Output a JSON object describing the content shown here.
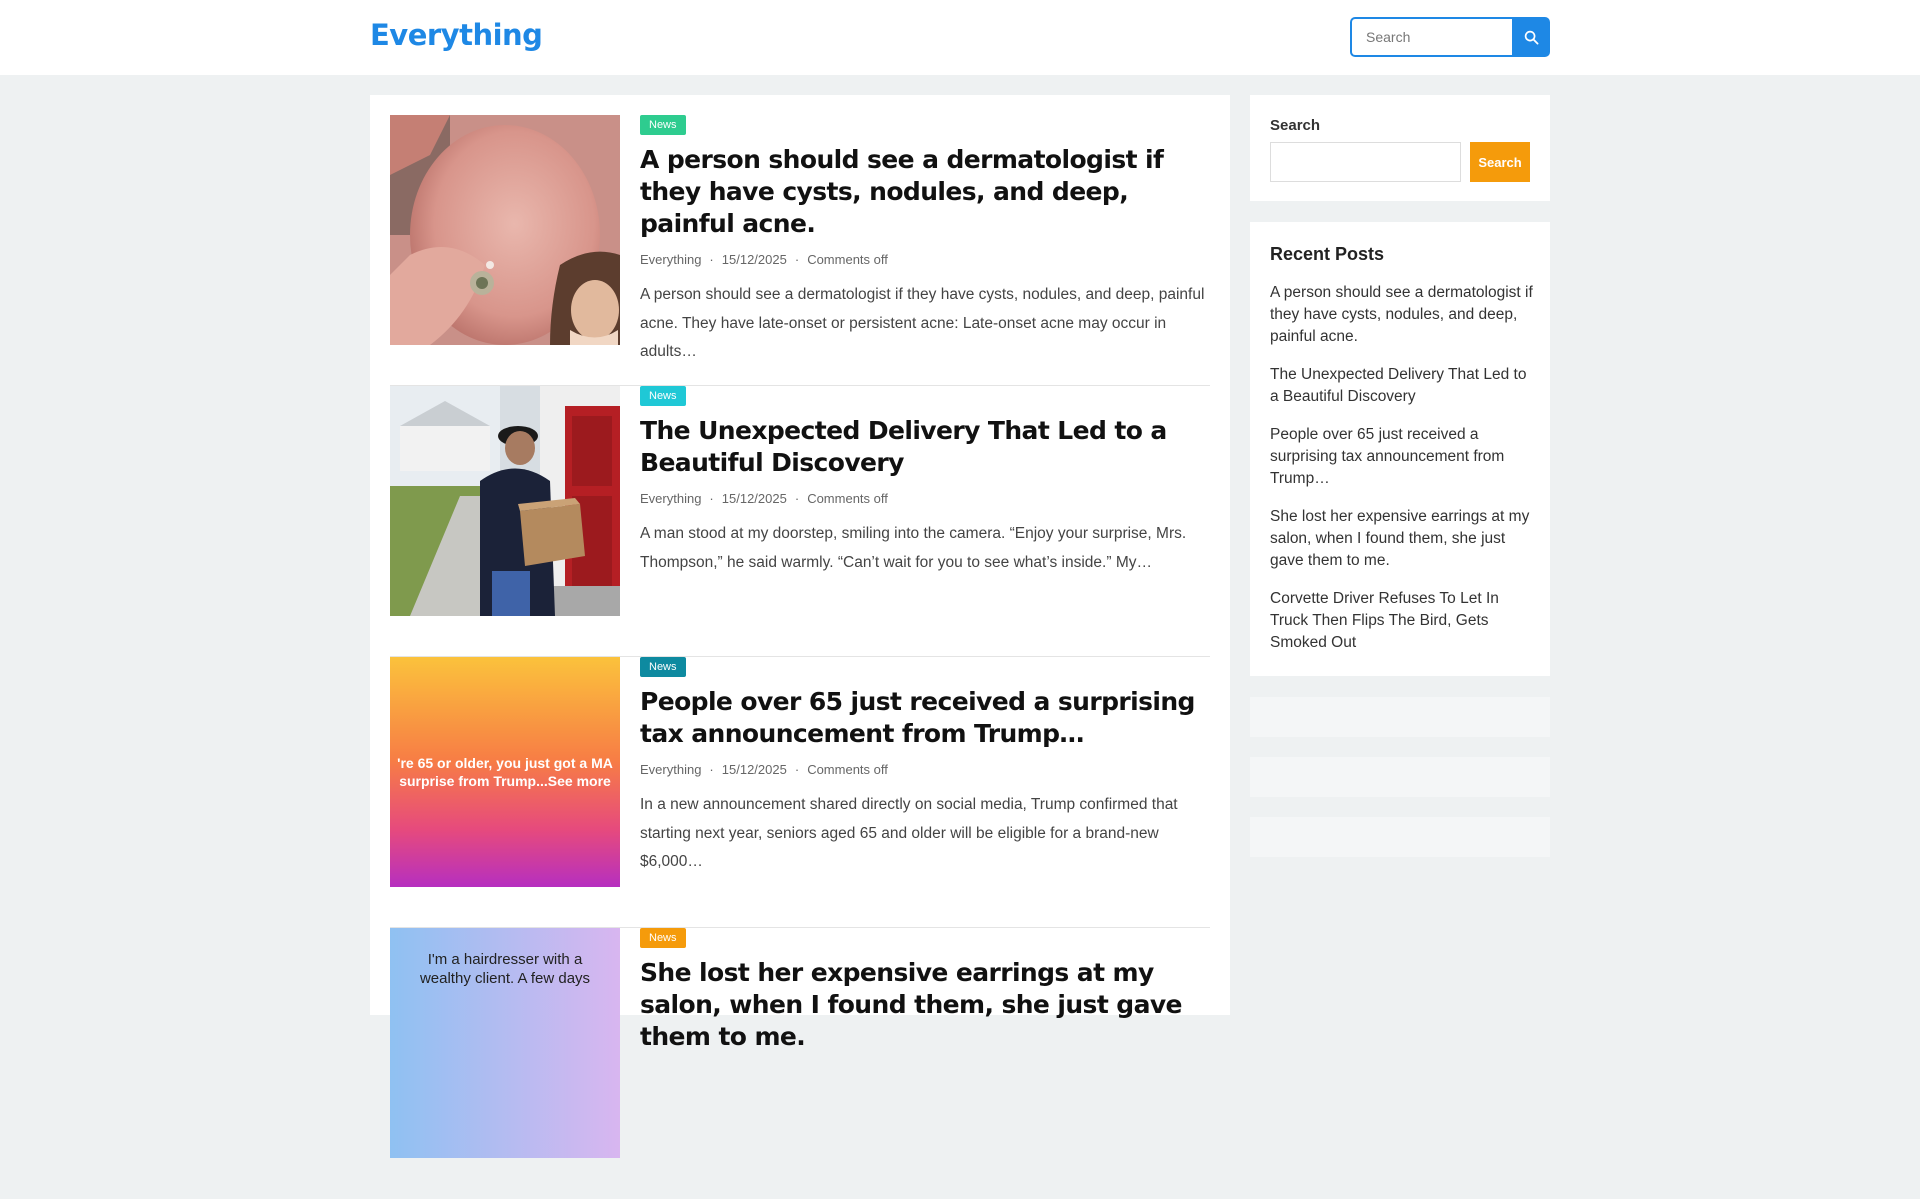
{
  "site": {
    "title": "Everything"
  },
  "header_search": {
    "placeholder": "Search"
  },
  "posts": [
    {
      "category": "News",
      "category_color": "#2ecc8f",
      "title": "A person should see a dermatologist if they have cysts, nodules, and deep, painful acne.",
      "author": "Everything",
      "date": "15/12/2025",
      "comments": "Comments off",
      "excerpt": "A person should see a dermatologist if they have cysts, nodules, and deep, painful acne. They have late-onset or persistent acne: Late-onset acne may occur in adults…"
    },
    {
      "category": "News",
      "category_color": "#1fc8d6",
      "title": "The Unexpected Delivery That Led to a Beautiful Discovery",
      "author": "Everything",
      "date": "15/12/2025",
      "comments": "Comments off",
      "excerpt": "A man stood at my doorstep, smiling into the camera. “Enjoy your surprise, Mrs. Thompson,” he said warmly. “Can’t wait for you to see what’s inside.” My…"
    },
    {
      "category": "News",
      "category_color": "#0e8aa0",
      "title": "People over 65 just received a surprising tax announcement from Trump…",
      "author": "Everything",
      "date": "15/12/2025",
      "comments": "Comments off",
      "excerpt": "In a new announcement shared directly on social media, Trump confirmed that starting next year, seniors aged 65 and older will be eligible for a brand-new $6,000…",
      "image_text": "'re 65 or older, you just got a MA\nsurprise from Trump...See more"
    },
    {
      "category": "News",
      "category_color": "#f59b0b",
      "title": "She lost her expensive earrings at my salon, when I found them, she just gave them to me.",
      "image_text": "I'm a hairdresser with a\nwealthy client. A few days"
    }
  ],
  "sidebar": {
    "search": {
      "label": "Search",
      "button": "Search"
    },
    "recent": {
      "title": "Recent Posts",
      "items": [
        "A person should see a dermatologist if they have cysts, nodules, and deep, painful acne.",
        "The Unexpected Delivery That Led to a Beautiful Discovery",
        "People over 65 just received a surprising tax announcement from Trump…",
        "She lost her expensive earrings at my salon, when I found them, she just gave them to me.",
        "Corvette Driver Refuses To Let In Truck Then Flips The Bird, Gets Smoked Out"
      ]
    }
  },
  "colors": {
    "brand": "#1e88e5",
    "accent": "#f59b0b",
    "page_bg": "#eef1f2"
  }
}
